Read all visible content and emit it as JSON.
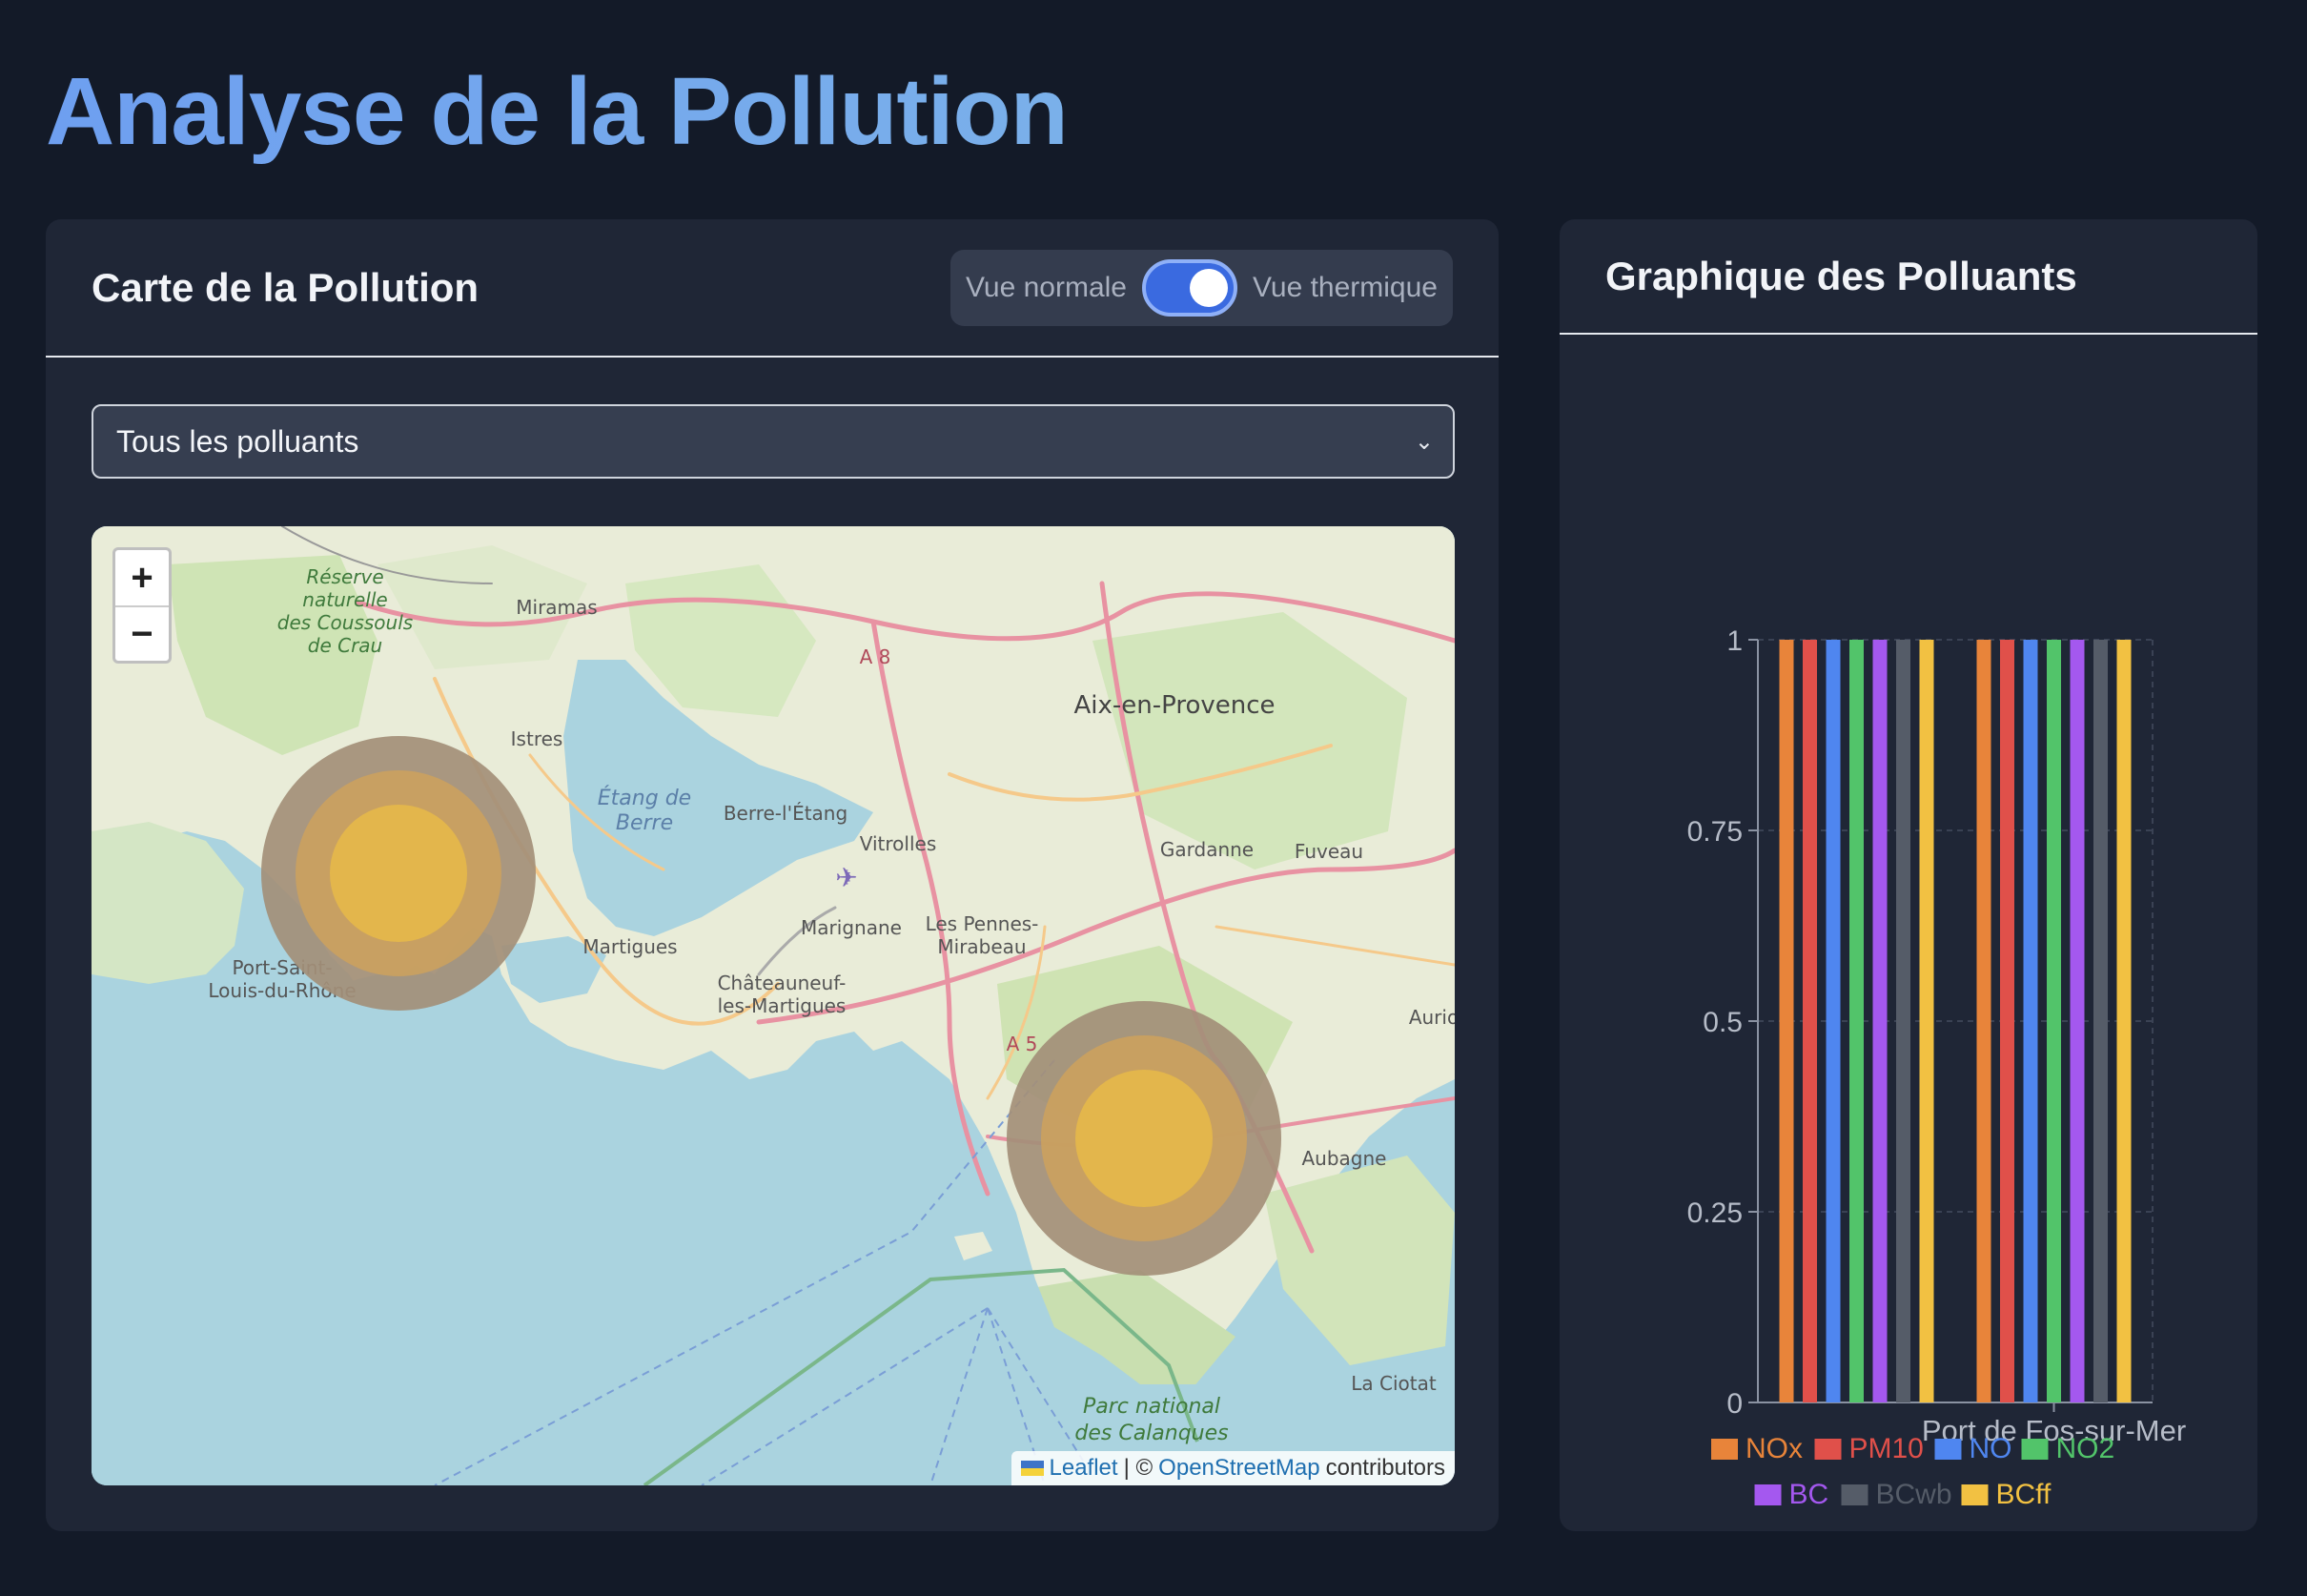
{
  "title": "Analyse de la Pollution",
  "map_card": {
    "title": "Carte de la Pollution",
    "toggle": {
      "left_label": "Vue normale",
      "right_label": "Vue thermique",
      "on": true
    },
    "select": {
      "value": "Tous les polluants"
    },
    "zoom": {
      "in": "+",
      "out": "−"
    },
    "attribution": {
      "leaflet": "Leaflet",
      "separator": "| ©",
      "osm": "OpenStreetMap",
      "suffix": "contributors"
    },
    "places": {
      "reserve": [
        "Réserve",
        "naturelle",
        "des Coussouls",
        "de Crau"
      ],
      "miramas": "Miramas",
      "a8": "A 8",
      "aix": "Aix-en-Provence",
      "istres": "Istres",
      "etang": [
        "Étang de",
        "Berre"
      ],
      "berre": "Berre-l'Étang",
      "vitrolles": "Vitrolles",
      "gardanne": "Gardanne",
      "fuveau": "Fuveau",
      "marignane": "Marignane",
      "pennes": [
        "Les Pennes-",
        "Mirabeau"
      ],
      "martigues": "Martigues",
      "chateauneuf": [
        "Châteauneuf-",
        "les-Martigues"
      ],
      "port_saint": [
        "Port-Saint-",
        "Louis-du-Rhône"
      ],
      "a55": "A 5",
      "auriol": "Aurio",
      "aubagne": "Aubagne",
      "calanques": [
        "Parc national",
        "des Calanques"
      ],
      "ciotat": "La Ciotat"
    }
  },
  "chart_card": {
    "title": "Graphique des Polluants"
  },
  "chart_data": {
    "type": "bar",
    "categories": [
      "",
      "Port de Fos-sur-Mer"
    ],
    "series": [
      {
        "name": "NOx",
        "color": "#e8843a",
        "values": [
          1,
          1
        ]
      },
      {
        "name": "PM10",
        "color": "#e0504a",
        "values": [
          1,
          1
        ]
      },
      {
        "name": "NO",
        "color": "#4f86f0",
        "values": [
          1,
          1
        ]
      },
      {
        "name": "NO2",
        "color": "#52c46a",
        "values": [
          1,
          1
        ]
      },
      {
        "name": "BC",
        "color": "#a458ef",
        "values": [
          1,
          1
        ]
      },
      {
        "name": "BCwb",
        "color": "#555c68",
        "values": [
          1,
          1
        ]
      },
      {
        "name": "BCff",
        "color": "#f2c142",
        "values": [
          1,
          1
        ]
      }
    ],
    "yticks": [
      "0",
      "0.25",
      "0.5",
      "0.75",
      "1"
    ],
    "ylim": [
      0,
      1
    ],
    "legend": "bottom",
    "grid": true
  }
}
